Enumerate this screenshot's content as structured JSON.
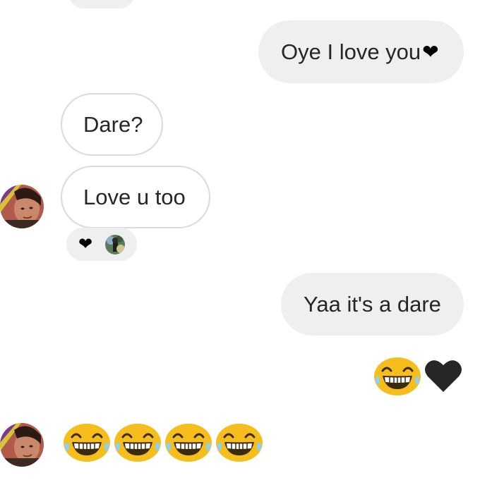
{
  "conversation": {
    "messages": [
      {
        "direction": "outgoing",
        "text": "Oye I love you",
        "trailing_icon": "black-heart-icon"
      },
      {
        "direction": "incoming",
        "text": "Dare?"
      },
      {
        "direction": "incoming",
        "text": "Love u too",
        "reactions": [
          "black-heart-icon",
          "reactor-avatar"
        ]
      },
      {
        "direction": "outgoing",
        "text": "Yaa it's a dare"
      },
      {
        "direction": "outgoing",
        "emojis": [
          "laughing-tears-emoji-icon",
          "black-heart-icon"
        ]
      },
      {
        "direction": "incoming",
        "emojis": [
          "laughing-tears-emoji-icon",
          "laughing-tears-emoji-icon",
          "laughing-tears-emoji-icon",
          "laughing-tears-emoji-icon"
        ]
      }
    ]
  },
  "colors": {
    "outgoing_bubble": "#efefef",
    "incoming_border": "#dbdbdb",
    "text": "#262626",
    "emoji_yellow": "#f6be1c",
    "heart": "#000000"
  }
}
